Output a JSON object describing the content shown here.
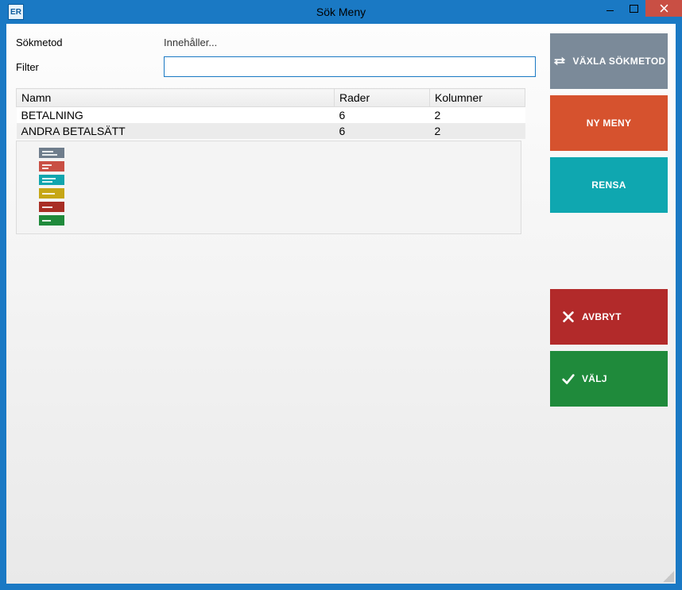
{
  "window": {
    "app_icon_text": "ER",
    "title": "Sök Meny"
  },
  "form": {
    "search_method_label": "Sökmetod",
    "search_method_value": "Innehåller...",
    "filter_label": "Filter",
    "filter_value": ""
  },
  "table": {
    "headers": {
      "name": "Namn",
      "rows": "Rader",
      "cols": "Kolumner"
    },
    "rows": [
      {
        "name": "BETALNING",
        "rows": "6",
        "cols": "2"
      },
      {
        "name": "ANDRA BETALSÄTT",
        "rows": "6",
        "cols": "2"
      }
    ]
  },
  "preview_colors": [
    "gray",
    "red",
    "teal",
    "yellow",
    "darkred",
    "green"
  ],
  "actions": {
    "toggle_search": "VÄXLA SÖKMETOD",
    "new_menu": "NY MENY",
    "clear": "RENSA",
    "cancel": "AVBRYT",
    "select": "VÄLJ"
  }
}
